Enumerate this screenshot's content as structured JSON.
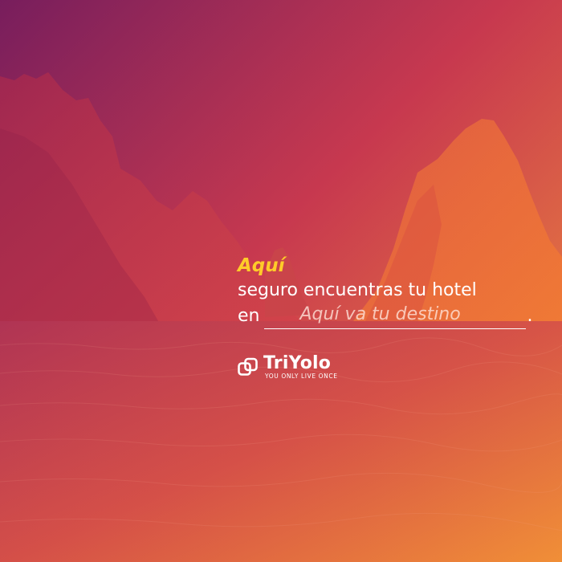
{
  "colors": {
    "headline": "#ffcc29",
    "text": "#ffffff",
    "gradient_top_left": "#7d1f5c",
    "gradient_mid": "#d8404f",
    "gradient_bottom_right": "#f08a2c"
  },
  "message": {
    "headline": "Aquí",
    "line1": "seguro encuentras tu hotel",
    "line2_prefix": "en",
    "destination_placeholder": "Aquí va tu destino",
    "line2_suffix": "."
  },
  "brand": {
    "logo_icon": "triyolo-logo-icon",
    "name": "TriYolo",
    "tagline": "YOU ONLY LIVE ONCE"
  }
}
